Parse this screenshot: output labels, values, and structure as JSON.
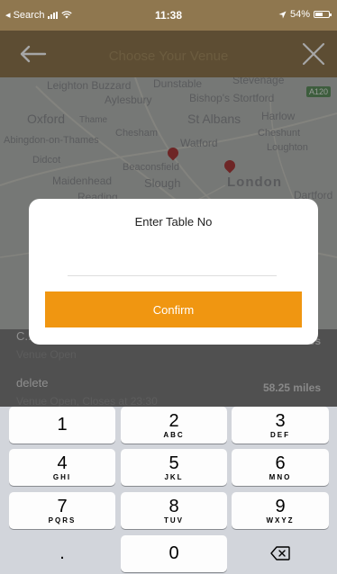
{
  "status_bar": {
    "back_app": "◂ Search",
    "time": "11:38",
    "battery": "54%",
    "battery_fraction": 0.54,
    "icons": [
      "signal-icon",
      "wifi-icon",
      "location-arrow-icon",
      "battery-icon"
    ]
  },
  "header": {
    "title": "Choose Your Venue",
    "icons": [
      "back-arrow-icon",
      "close-icon"
    ]
  },
  "map": {
    "towns": [
      "Leighton Buzzard",
      "Dunstable",
      "Stevenage",
      "Aylesbury",
      "Bishop's Stortford",
      "Oxford",
      "Thame",
      "St Albans",
      "Harlow",
      "Abingdon-on-Thames",
      "Chesham",
      "Watford",
      "Cheshunt",
      "Didcot",
      "Beaconsfield",
      "Loughton",
      "Maidenhead",
      "Slough",
      "London",
      "Reading",
      "Dartford"
    ],
    "road": "A120"
  },
  "venue_list": [
    {
      "name": "C...",
      "sub": "Venue Open",
      "distance": "...es"
    },
    {
      "name": "delete",
      "sub": "Venue Open, Closes at 23:30",
      "distance": "58.25 miles"
    }
  ],
  "modal": {
    "title": "Enter Table No",
    "input_value": "",
    "input_placeholder": "",
    "confirm_label": "Confirm"
  },
  "keypad": {
    "keys": [
      {
        "num": "1",
        "letters": ""
      },
      {
        "num": "2",
        "letters": "ABC"
      },
      {
        "num": "3",
        "letters": "DEF"
      },
      {
        "num": "4",
        "letters": "GHI"
      },
      {
        "num": "5",
        "letters": "JKL"
      },
      {
        "num": "6",
        "letters": "MNO"
      },
      {
        "num": "7",
        "letters": "PQRS"
      },
      {
        "num": "8",
        "letters": "TUV"
      },
      {
        "num": "9",
        "letters": "WXYZ"
      },
      {
        "num": ".",
        "letters": ""
      },
      {
        "num": "0",
        "letters": ""
      }
    ],
    "delete_icon": "backspace-icon"
  },
  "colors": {
    "header_bg": "#8f774f",
    "accent": "#f09611",
    "keypad_bg": "#d2d5db"
  }
}
